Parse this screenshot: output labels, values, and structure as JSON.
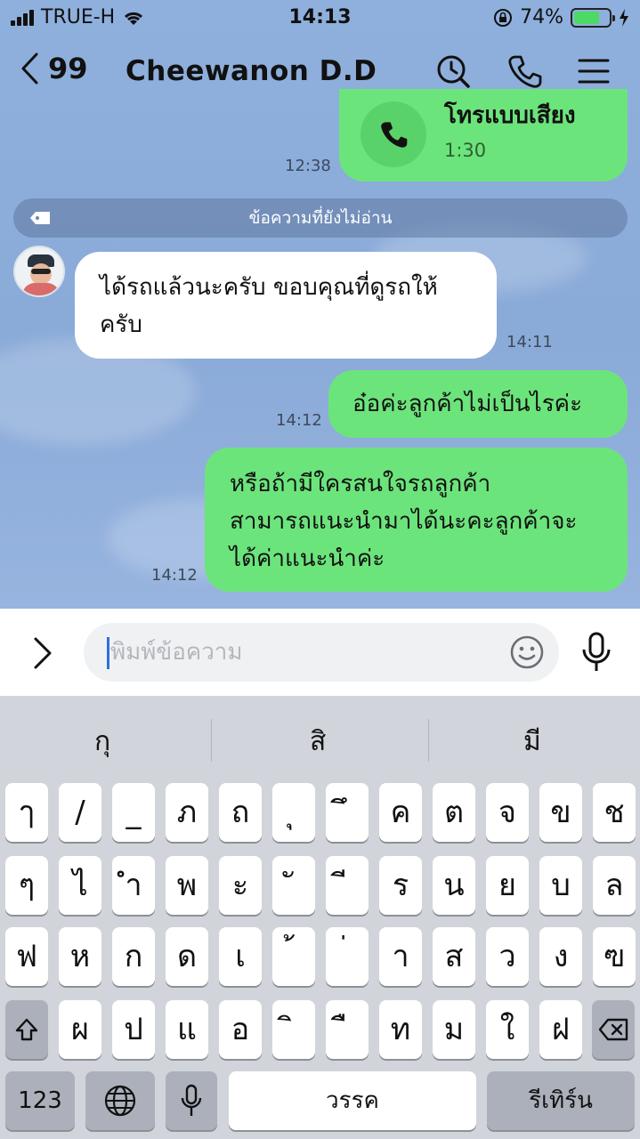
{
  "status_bar": {
    "carrier": "TRUE-H",
    "time": "14:13",
    "battery": "74%"
  },
  "header": {
    "back_count": "99",
    "title": "Cheewanon  D.D"
  },
  "messages": [
    {
      "id": "call",
      "call_label": "โทรแบบเสียง",
      "duration": "1:30",
      "time": "12:38"
    },
    {
      "id": "unread",
      "text": "ข้อความที่ยังไม่อ่าน"
    },
    {
      "id": "in1",
      "lines": [
        "ได้รถแล้วนะครับ ขอบคุณที่ดูรถให้",
        "ครับ"
      ],
      "time": "14:11"
    },
    {
      "id": "out1",
      "lines": [
        "อ๋อค่ะลูกค้าไม่เป็นไรค่ะ"
      ],
      "time": "14:12"
    },
    {
      "id": "out2",
      "lines": [
        "หรือถ้ามีใครสนใจรถลูกค้า",
        "สามารถแนะนำมาได้นะคะลูกค้าจะ",
        "ได้ค่าแนะนำค่ะ"
      ],
      "time": "14:12"
    }
  ],
  "input": {
    "placeholder": "พิมพ์ข้อความ"
  },
  "keyboard": {
    "suggestions": [
      "กุ",
      "สิ",
      "มี"
    ],
    "rows": [
      [
        "ๅ",
        "/",
        "_",
        "ภ",
        "ถ",
        "ุ",
        "ึ",
        "ค",
        "ต",
        "จ",
        "ข",
        "ช"
      ],
      [
        "ๆ",
        "ไ",
        "ำ",
        "พ",
        "ะ",
        "ั",
        "ี",
        "ร",
        "น",
        "ย",
        "บ",
        "ล"
      ],
      [
        "ฟ",
        "ห",
        "ก",
        "ด",
        "เ",
        "้",
        "่",
        "า",
        "ส",
        "ว",
        "ง",
        "ฃ"
      ],
      [
        "ผ",
        "ป",
        "แ",
        "อ",
        "ิ",
        "ื",
        "ท",
        "ม",
        "ใ",
        "ฝ"
      ]
    ],
    "numbers_label": "123",
    "space_label": "วรรค",
    "return_label": "รีเทิร์น"
  }
}
